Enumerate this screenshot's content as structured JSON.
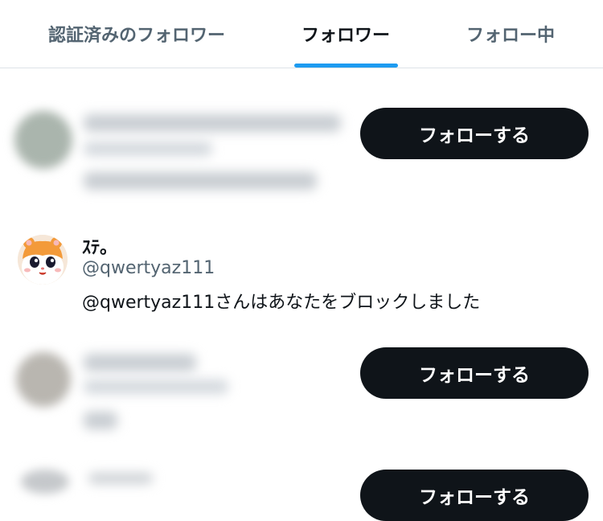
{
  "tabs": [
    {
      "label": "認証済みのフォロワー",
      "active": false
    },
    {
      "label": "フォロワー",
      "active": true
    },
    {
      "label": "フォロー中",
      "active": false
    }
  ],
  "accent_color": "#1d9bf0",
  "follow_button_label": "フォローする",
  "users": [
    {
      "blurred": true,
      "has_follow_button": true
    },
    {
      "blurred": false,
      "display_name": "ｽﾃ。",
      "handle": "@qwertyaz111",
      "status_message": "@qwertyaz111さんはあなたをブロックしました",
      "avatar_icon": "hamster-avatar-icon",
      "has_follow_button": false
    },
    {
      "blurred": true,
      "has_follow_button": true
    },
    {
      "blurred": true,
      "has_follow_button": true
    }
  ]
}
